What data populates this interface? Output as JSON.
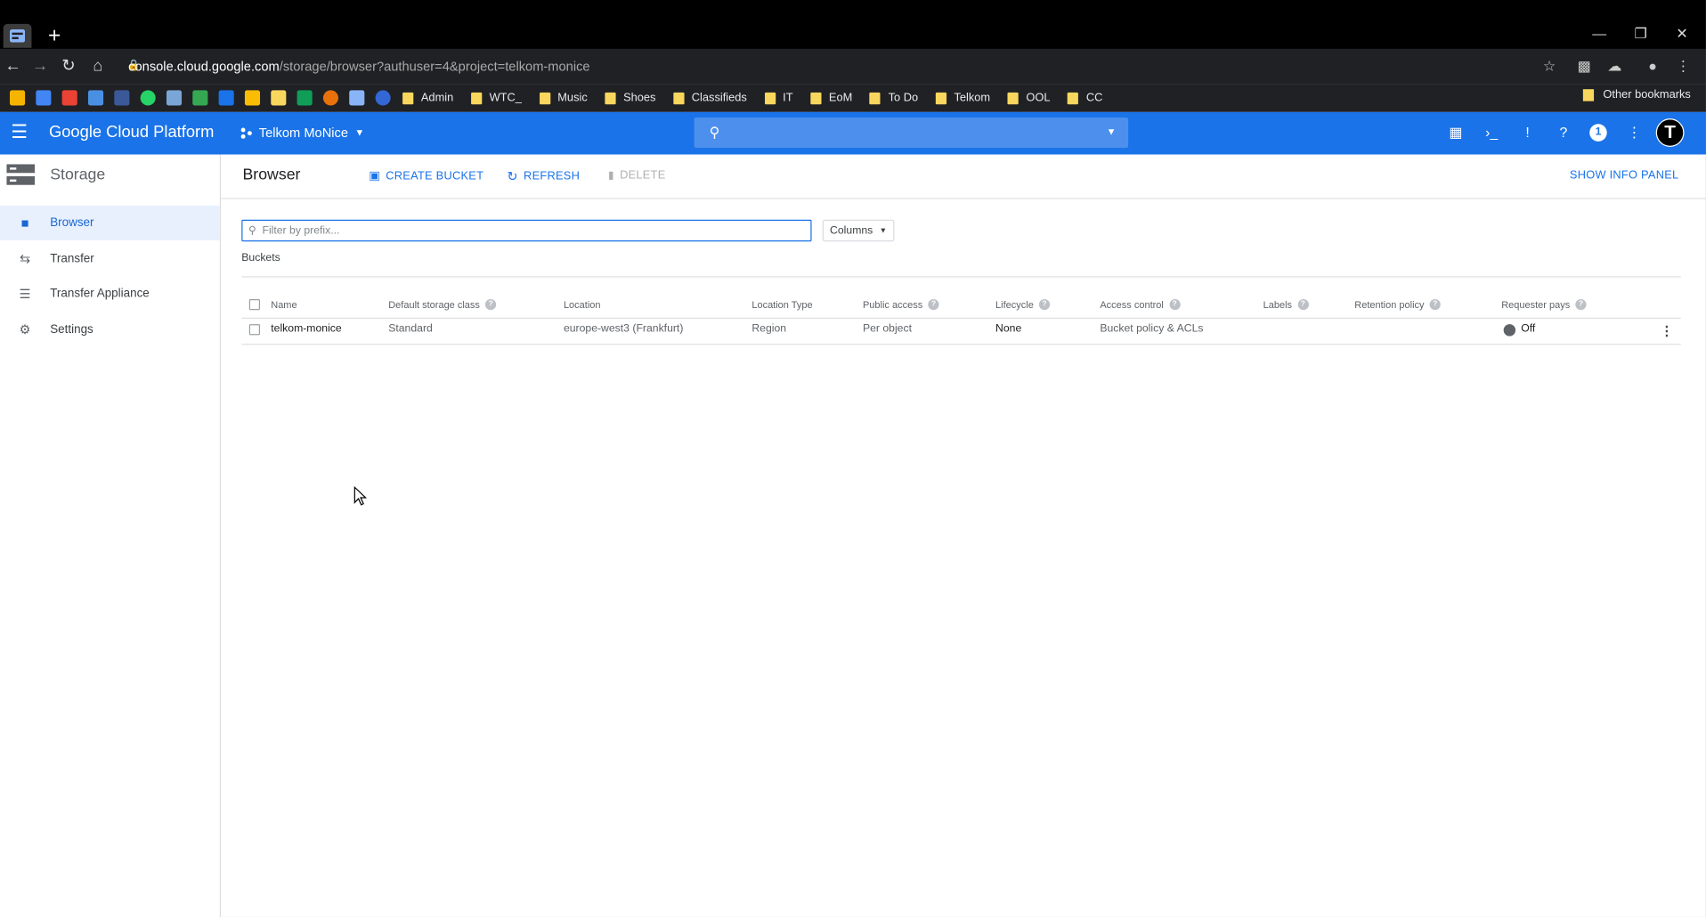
{
  "browser": {
    "address_host": "console.cloud.google.com",
    "address_path": "/storage/browser?authuser=4&project=telkom-monice",
    "bookmark_folders": [
      "Admin",
      "WTC_",
      "Music",
      "Shoes",
      "Classifieds",
      "IT",
      "EoM",
      "To Do",
      "Telkom",
      "OOL",
      "CC"
    ],
    "other_bookmarks": "Other bookmarks",
    "icons": [
      "back-icon",
      "forward-icon",
      "reload-icon",
      "home-icon",
      "lock-icon",
      "star-icon"
    ]
  },
  "header": {
    "product": "Google Cloud Platform",
    "project": "Telkom MoNice",
    "notification_count": "1",
    "avatar_letter": "T",
    "accent": "#1a73e8"
  },
  "sidebar": {
    "title": "Storage",
    "items": [
      {
        "label": "Browser",
        "icon": "bucket-icon",
        "active": true
      },
      {
        "label": "Transfer",
        "icon": "transfer-arrows-icon",
        "active": false
      },
      {
        "label": "Transfer Appliance",
        "icon": "list-icon",
        "active": false
      },
      {
        "label": "Settings",
        "icon": "gear-icon",
        "active": false
      }
    ]
  },
  "main": {
    "title": "Browser",
    "actions": {
      "create": "CREATE BUCKET",
      "refresh": "REFRESH",
      "delete": "DELETE"
    },
    "show_info_panel": "SHOW INFO PANEL",
    "filter_placeholder": "Filter by prefix...",
    "columns_button": "Columns",
    "section_label": "Buckets",
    "table": {
      "headers": [
        "Name",
        "Default storage class",
        "Location",
        "Location Type",
        "Public access",
        "Lifecycle",
        "Access control",
        "Labels",
        "Retention policy",
        "Requester pays"
      ],
      "rows": [
        {
          "name": "telkom-monice",
          "storage_class": "Standard",
          "location": "europe-west3 (Frankfurt)",
          "location_type": "Region",
          "public_access": "Per object",
          "lifecycle": "None",
          "access_control": "Bucket policy & ACLs",
          "labels": "",
          "retention_policy": "",
          "requester_pays": "Off"
        }
      ]
    }
  }
}
